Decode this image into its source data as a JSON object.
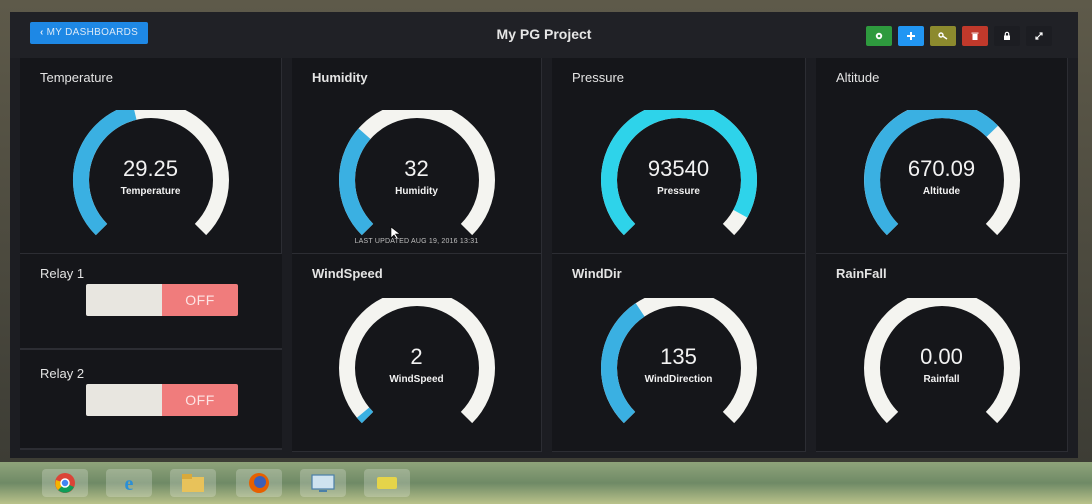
{
  "header": {
    "back_label": "MY DASHBOARDS",
    "title": "My PG Project"
  },
  "toolbar": [
    {
      "name": "gear-icon",
      "color": "#2e9a3e"
    },
    {
      "name": "plus-icon",
      "color": "#2196f3"
    },
    {
      "name": "key-icon",
      "color": "#8c8a2e"
    },
    {
      "name": "trash-icon",
      "color": "#c0392b"
    },
    {
      "name": "lock-icon",
      "color": "#1c1d22"
    },
    {
      "name": "expand-icon",
      "color": "#1c1d22"
    }
  ],
  "gauges": {
    "temperature": {
      "label": "Temperature",
      "value": "29.25",
      "sub": "Temperature",
      "fill": 0.45
    },
    "humidity": {
      "label": "Humidity",
      "value": "32",
      "sub": "Humidity",
      "fill": 0.32
    },
    "pressure": {
      "label": "Pressure",
      "value": "93540",
      "sub": "Pressure",
      "fill": 0.94
    },
    "altitude": {
      "label": "Altitude",
      "value": "670.09",
      "sub": "Altitude",
      "fill": 0.67
    },
    "windspeed": {
      "label": "WindSpeed",
      "value": "2",
      "sub": "WindSpeed",
      "fill": 0.02
    },
    "winddir": {
      "label": "WindDir",
      "value": "135",
      "sub": "WindDirection",
      "fill": 0.375
    },
    "rainfall": {
      "label": "RainFall",
      "value": "0.00",
      "sub": "Rainfall",
      "fill": 0.0
    }
  },
  "last_updated": "LAST UPDATED AUG 19, 2016 13:31",
  "relays": {
    "relay1": {
      "label": "Relay 1",
      "state": "OFF"
    },
    "relay2": {
      "label": "Relay 2",
      "state": "OFF"
    }
  },
  "colors": {
    "gauge_fill": "#3ab0e2",
    "gauge_fill_bright": "#2ed3ea",
    "gauge_track": "#f4f4f0",
    "toggle_off": "#f07c7c"
  },
  "taskbar": [
    {
      "name": "chrome-icon"
    },
    {
      "name": "internet-explorer-icon"
    },
    {
      "name": "file-explorer-icon"
    },
    {
      "name": "firefox-icon"
    },
    {
      "name": "control-panel-icon"
    },
    {
      "name": "app-icon"
    }
  ]
}
